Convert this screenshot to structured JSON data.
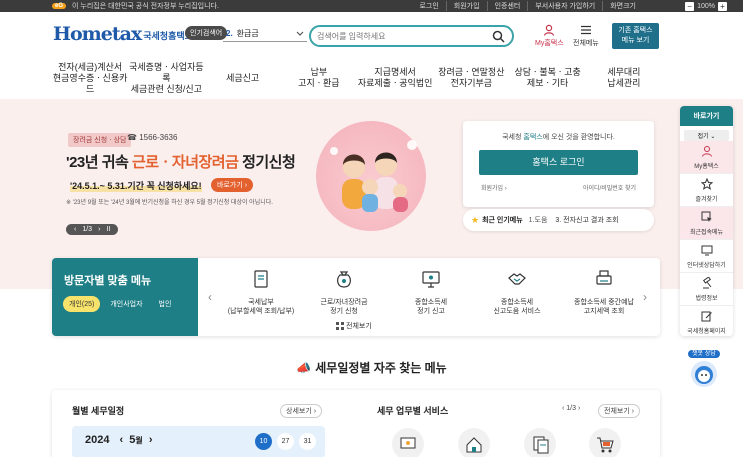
{
  "topbar": {
    "gov_mark": "eG",
    "gov_text": "이 누리집은 대한민국 공식 전자정부 누리집입니다.",
    "links": [
      "로그인",
      "회원가입",
      "인증센터",
      "부서사용자 가입하기",
      "화면크기"
    ],
    "zoom_minus": "−",
    "zoom_value": "100%",
    "zoom_plus": "+"
  },
  "header": {
    "logo_text": "Hometax",
    "logo_sub": "국세청홈택스",
    "hot_label": "인기검색어",
    "hot_num": "2.",
    "hot_value": "환급금",
    "search_placeholder": "검색어를 입력하세요",
    "my_hometax": "My홈택스",
    "all_menu": "전체메뉴",
    "eng_btn_line1": "기존 홈택스",
    "eng_btn_line2": "메뉴 보기"
  },
  "gnb": [
    [
      "전자(세금)계산서",
      "현금영수증ㆍ신용카드"
    ],
    [
      "국세증명ㆍ사업자등록",
      "세금관련 신청/신고"
    ],
    [
      "세금신고",
      ""
    ],
    [
      "납부",
      "고지ㆍ환급"
    ],
    [
      "지급명세서",
      "자료제출ㆍ공익법인"
    ],
    [
      "장려금ㆍ연말정산",
      "전자기부금"
    ],
    [
      "상담ㆍ불복ㆍ고충",
      "제보ㆍ기타"
    ],
    [
      "세무대리",
      "납세관리"
    ]
  ],
  "hero": {
    "tag": "장려금 신청ㆍ상담",
    "phone": "☎ 1566-3636",
    "title_a": "'23년 귀속 ",
    "title_accent": "근로ㆍ자녀장려금",
    "title_b": " 정기신청",
    "period": "'24.5.1.~ 5.31.기간 꼭 신청하세요!",
    "go_btn": "바로가기 ›",
    "note": "※ '23년 9월 또는 '24년 3월에 반기신청을 하신 경우 5월 정기신청 대상이 아닙니다.",
    "pager": "1/3",
    "pager_prev": "‹",
    "pager_next": "›",
    "pager_pause": "II"
  },
  "login": {
    "welcome_a": "국세청 ",
    "welcome_b": "홈택스",
    "welcome_c": "에 오신 것을 환영합니다.",
    "button": "홈택스 로그인",
    "join": "회원가입 ›",
    "find": "아이디/비밀번호 찾기"
  },
  "popular": {
    "title": "최근 인기메뉴",
    "item1": "1.도움",
    "item2": "3. 전자신고 결과 조회"
  },
  "visitor": {
    "title": "방문자별 맞춤 메뉴",
    "tabs": [
      "개인(25)",
      "개인사업자",
      "법인"
    ],
    "items": [
      [
        "국세납부",
        "(납부할세액 조회/납부)"
      ],
      [
        "근로/자녀장려금",
        "정기 신청"
      ],
      [
        "종합소득세",
        "정기 신고"
      ],
      [
        "종합소득세",
        "신고도움 서비스"
      ],
      [
        "종합소득세 중간예납",
        "고지세액 조회"
      ]
    ],
    "more": "전체보기"
  },
  "side": {
    "title": "바로가기",
    "fold": "접기 ⌄",
    "items": [
      "My홈택스",
      "즐겨찾기",
      "최근접속메뉴",
      "인터넷상담하기",
      "법령정보",
      "국세청홈페이지"
    ]
  },
  "chatbot": {
    "label": "챗봇 상담"
  },
  "schedule": {
    "title": "세무일정별 자주 찾는 메뉴",
    "left_title": "월별 세무일정",
    "left_more": "상세보기 ›",
    "year": "2024",
    "month": "5",
    "month_unit": "월",
    "days": [
      "10",
      "27",
      "31"
    ],
    "right_title": "세무 업무별 서비스",
    "right_pager": "‹  1/3  ›",
    "right_more": "전체보기 ›"
  },
  "colors": {
    "brand": "#1f7f86",
    "accent": "#e3612f",
    "hero_bg": "#fbefee"
  }
}
